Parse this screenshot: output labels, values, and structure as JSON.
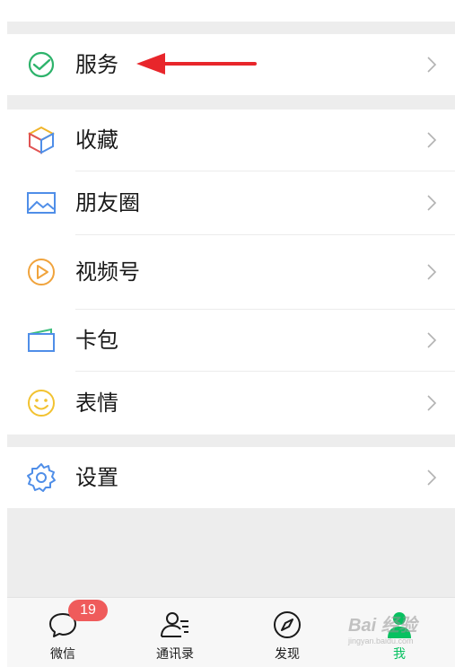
{
  "menu": {
    "service": {
      "label": "服务",
      "icon": "service-check-icon"
    },
    "items": [
      {
        "label": "收藏",
        "icon": "favorites-cube-icon"
      },
      {
        "label": "朋友圈",
        "icon": "moments-picture-icon"
      },
      {
        "label": "视频号",
        "icon": "channels-play-icon"
      },
      {
        "label": "卡包",
        "icon": "card-wallet-icon"
      },
      {
        "label": "表情",
        "icon": "emoji-smile-icon"
      }
    ],
    "settings": {
      "label": "设置",
      "icon": "gear-icon"
    }
  },
  "annotation": {
    "color": "#e8262b"
  },
  "tabbar": {
    "tabs": [
      {
        "label": "微信",
        "icon": "chat-bubble-icon",
        "badge": "19"
      },
      {
        "label": "通讯录",
        "icon": "contacts-icon"
      },
      {
        "label": "发现",
        "icon": "compass-icon"
      },
      {
        "label": "我",
        "icon": "person-icon",
        "active": true
      }
    ]
  },
  "colors": {
    "active": "#07c160",
    "badge": "#ef5b5b",
    "label": "#191919",
    "background": "#ededed"
  },
  "watermark": {
    "text": "Bai 经验",
    "sub": "jingyan.baidu.com"
  }
}
